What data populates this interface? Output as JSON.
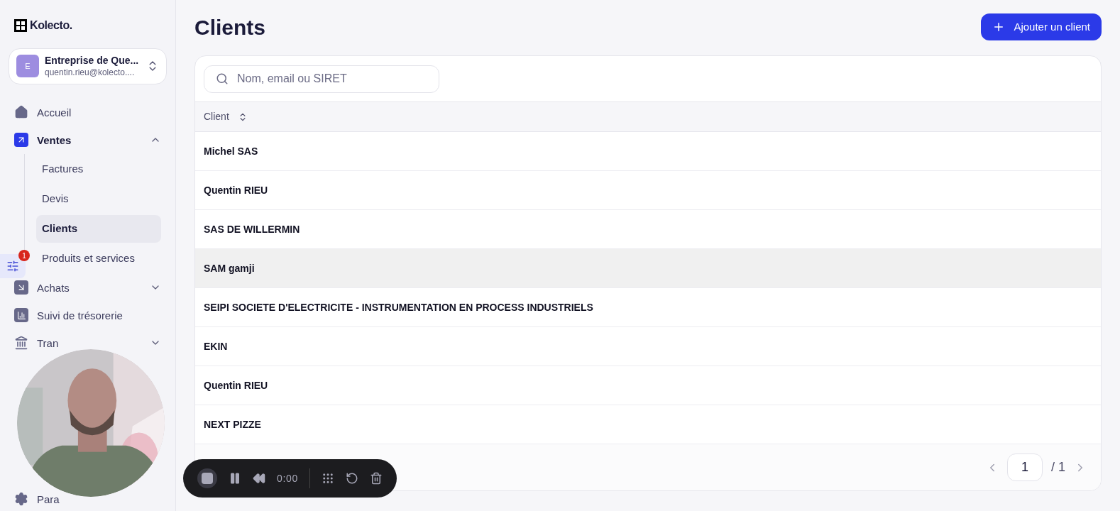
{
  "logo": "Kolecto.",
  "company": {
    "initial": "E",
    "name": "Entreprise de Que...",
    "email": "quentin.rieu@kolecto...."
  },
  "nav": [
    {
      "kind": "item",
      "label": "Accueil",
      "selected": false
    },
    {
      "kind": "group",
      "label": "Ventes",
      "expanded": true,
      "children": [
        {
          "label": "Factures",
          "selected": false
        },
        {
          "label": "Devis",
          "selected": false
        },
        {
          "label": "Clients",
          "selected": true
        },
        {
          "label": "Produits et services",
          "selected": false
        }
      ]
    },
    {
      "kind": "group",
      "label": "Achats",
      "expanded": false
    },
    {
      "kind": "item",
      "label": "Suivi de trésorerie",
      "selected": false
    },
    {
      "kind": "group",
      "label": "Tran",
      "expanded": false
    }
  ],
  "settings": {
    "label": "Para"
  },
  "filter_badge": "1",
  "title": "Clients",
  "add_button": "Ajouter un client",
  "search": {
    "placeholder": "Nom, email ou SIRET"
  },
  "table": {
    "columns": [
      "Client"
    ],
    "rows": [
      {
        "name": "Michel SAS",
        "highlighted": false
      },
      {
        "name": "Quentin RIEU",
        "highlighted": false
      },
      {
        "name": "SAS DE WILLERMIN",
        "highlighted": false
      },
      {
        "name": "SAM gamji",
        "highlighted": true
      },
      {
        "name": "SEIPI SOCIETE D'ELECTRICITE - INSTRUMENTATION EN PROCESS INDUSTRIELS",
        "highlighted": false
      },
      {
        "name": "EKIN",
        "highlighted": false
      },
      {
        "name": "Quentin RIEU",
        "highlighted": false
      },
      {
        "name": "NEXT PIZZE",
        "highlighted": false
      }
    ]
  },
  "pagination": {
    "page": "1",
    "total": "/ 1"
  },
  "recorder": {
    "time": "0:00"
  }
}
